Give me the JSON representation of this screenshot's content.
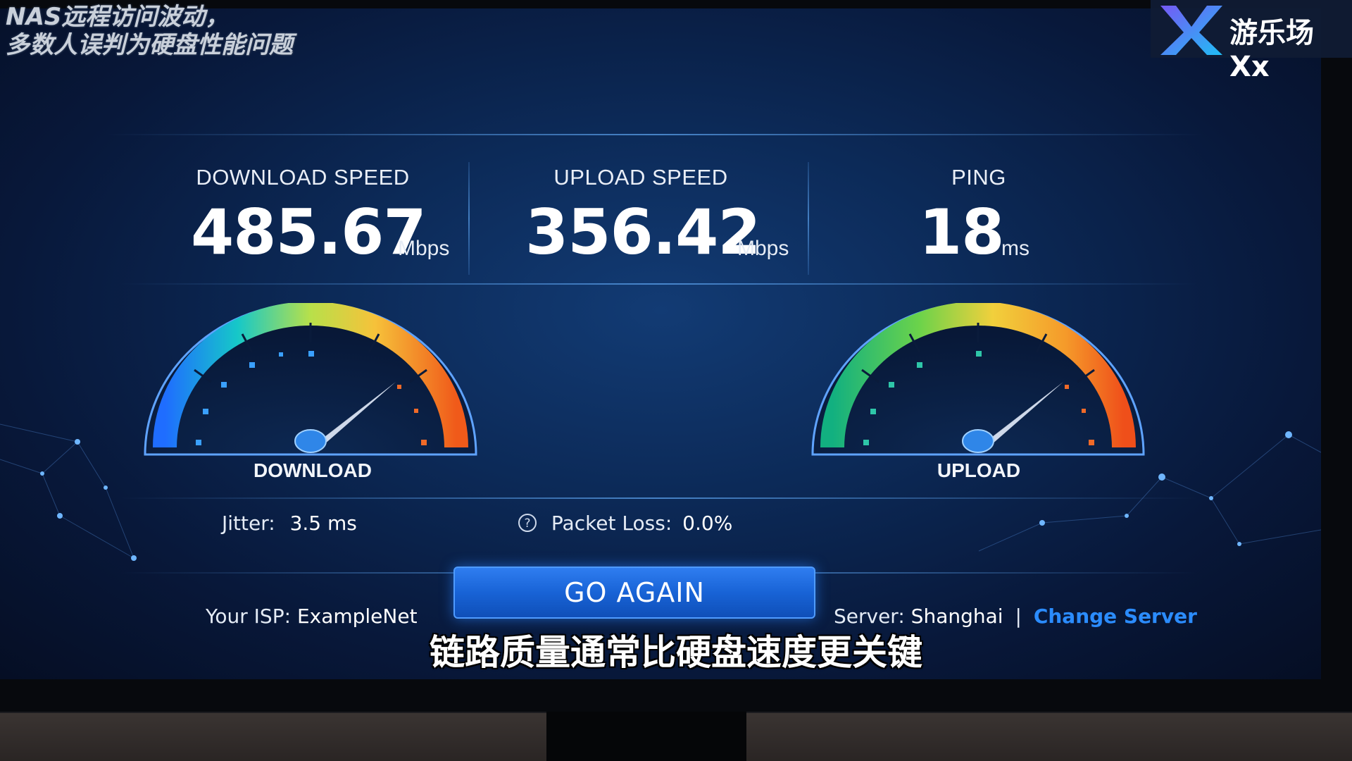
{
  "overlay": {
    "caption_line1": "NAS远程访问波动，",
    "caption_line2": "多数人误判为硬盘性能问题",
    "logo_text": "游乐场Xx",
    "subtitle": "链路质量通常比硬盘速度更关键"
  },
  "stats": {
    "download": {
      "label": "DOWNLOAD SPEED",
      "value": "485.67",
      "unit": "Mbps"
    },
    "upload": {
      "label": "UPLOAD SPEED",
      "value": "356.42",
      "unit": "Mbps"
    },
    "ping": {
      "label": "PING",
      "value": "18",
      "unit": "ms"
    }
  },
  "gauges": {
    "download": {
      "label": "DOWNLOAD"
    },
    "upload": {
      "label": "UPLOAD"
    }
  },
  "details": {
    "jitter_label": "Jitter:",
    "jitter_value": "3.5 ms",
    "packet_loss_label": "Packet Loss:",
    "packet_loss_value": "0.0%"
  },
  "actions": {
    "go_again": "GO AGAIN",
    "change_server": "Change Server"
  },
  "footer": {
    "isp_label": "Your ISP:",
    "isp_value": "ExampleNet",
    "server_label": "Server:",
    "server_value": "Shanghai",
    "separator": "|"
  },
  "colors": {
    "accent": "#2b8cff",
    "button": "#1863d6",
    "screen_bg": "#0c2a58"
  }
}
